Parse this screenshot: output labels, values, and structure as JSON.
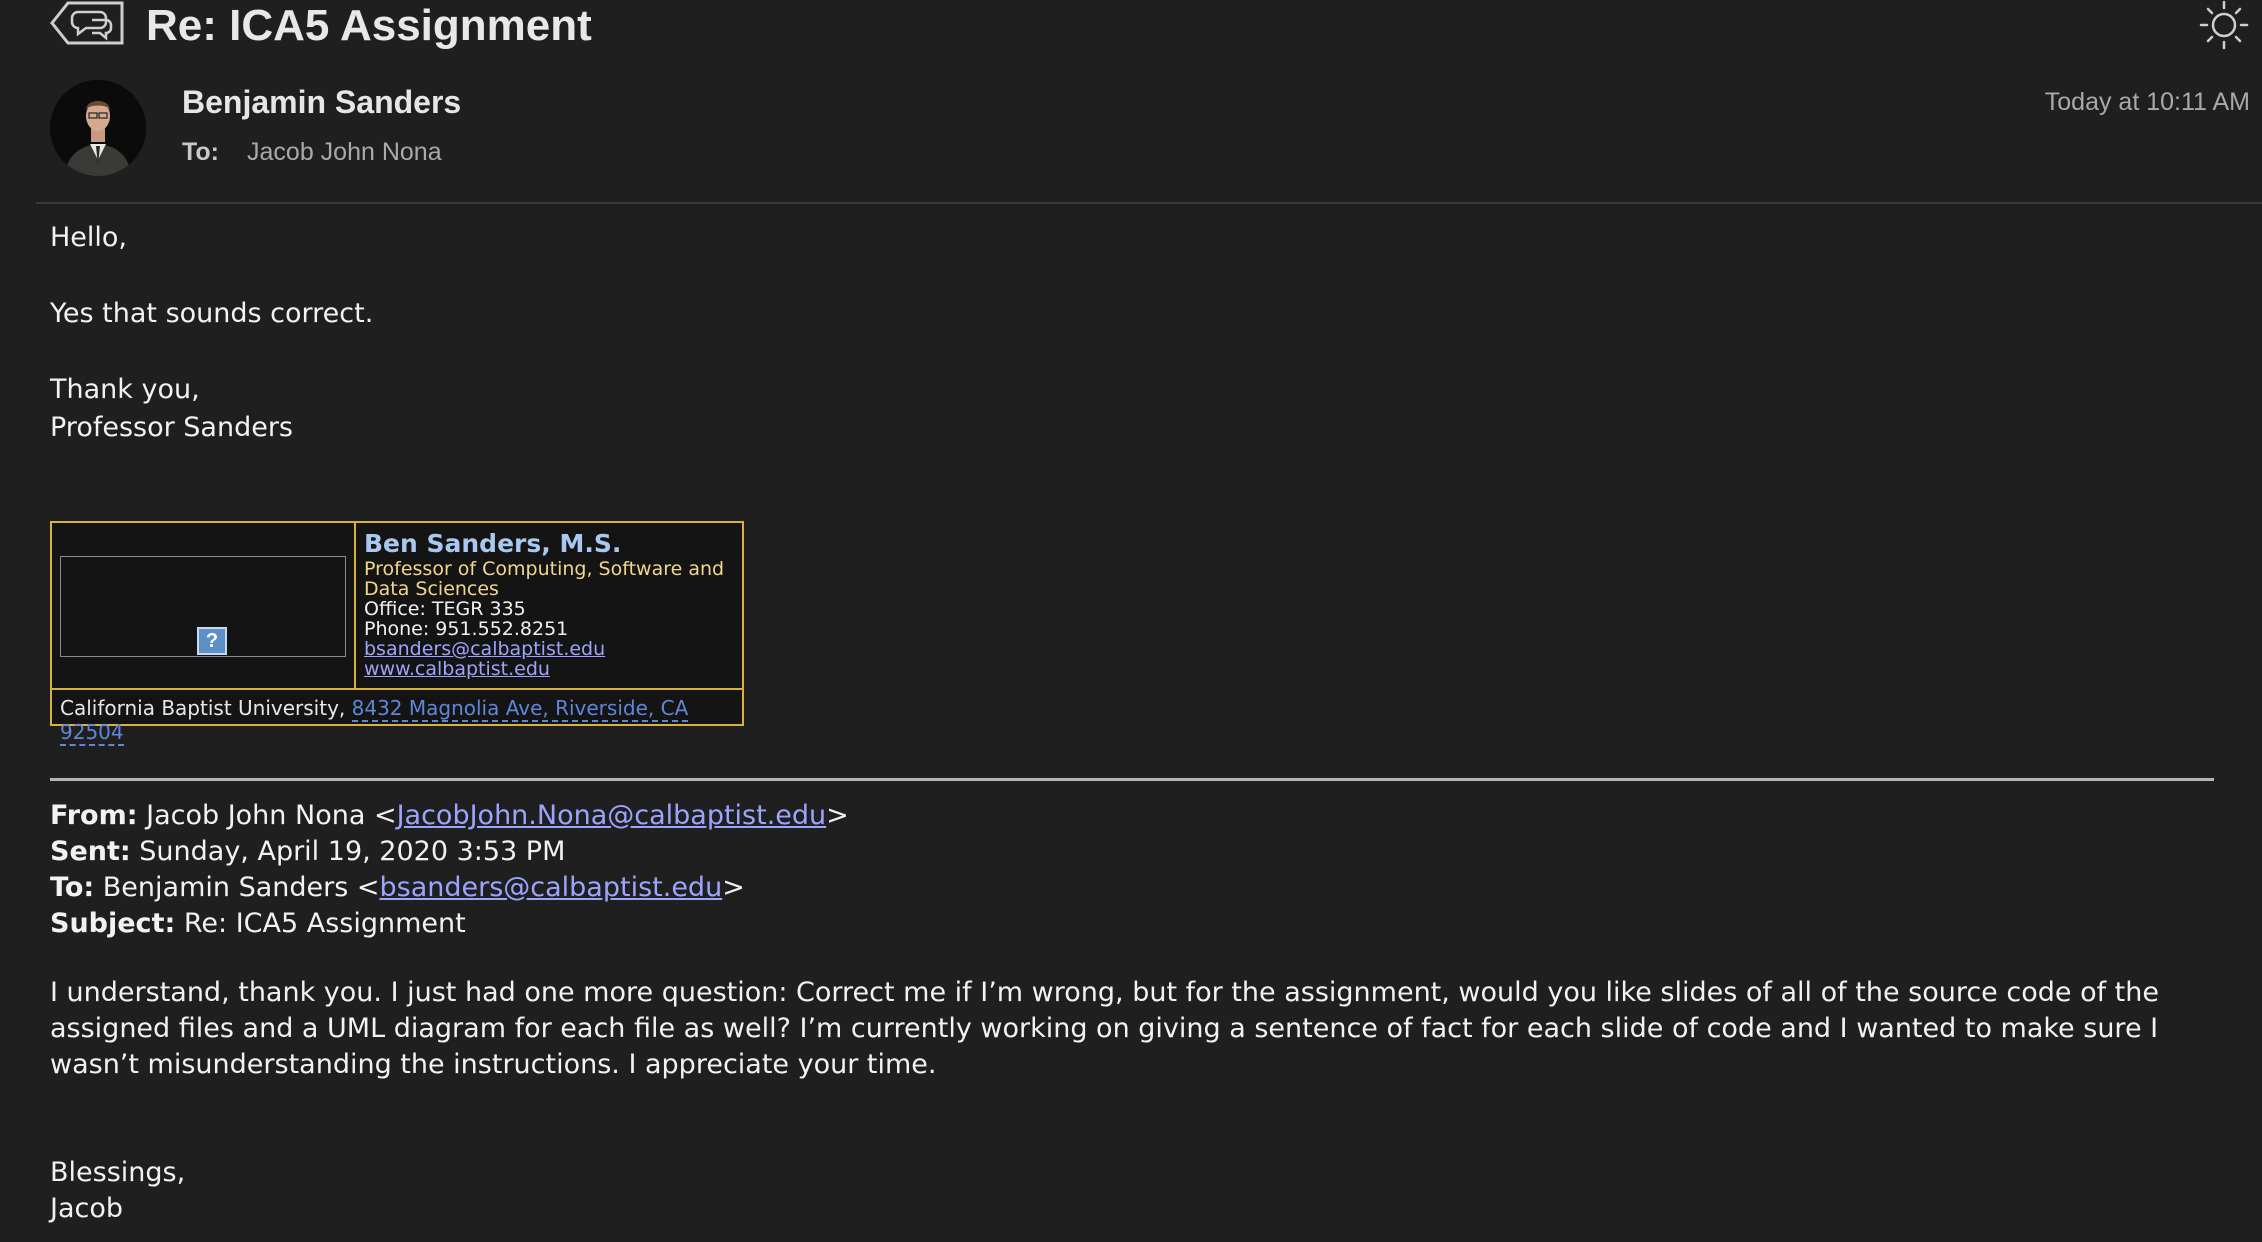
{
  "header": {
    "subject": "Re: ICA5 Assignment",
    "sender": "Benjamin Sanders",
    "to_label": "To:",
    "recipient": "Jacob John Nona",
    "timestamp": "Today at 10:11 AM"
  },
  "reply": {
    "greeting": "Hello,",
    "line1": "Yes that sounds correct.",
    "closing": "Thank you,",
    "signoff": "Professor Sanders"
  },
  "signature": {
    "image_placeholder": "?",
    "name": "Ben Sanders, M.S.",
    "title": "Professor of Computing, Software and Data Sciences",
    "office": "Office: TEGR 335",
    "phone": "Phone: 951.552.8251",
    "email": "bsanders@calbaptist.edu",
    "website": "www.calbaptist.edu",
    "university": "California Baptist University,",
    "address": "8432 Magnolia Ave, Riverside, CA 92504"
  },
  "quoted": {
    "from_label": "From:",
    "from_name": "Jacob John Nona <",
    "from_email": "JacobJohn.Nona@calbaptist.edu",
    "close_bracket": ">",
    "sent_label": "Sent:",
    "sent_value": "Sunday, April 19, 2020 3:53 PM",
    "to_label": "To:",
    "to_name": "Benjamin Sanders <",
    "to_email": "bsanders@calbaptist.edu",
    "subject_label": "Subject:",
    "subject_value": "Re: ICA5 Assignment",
    "message": "I understand, thank you. I just had one more question: Correct me if I’m wrong, but for the assignment, would you like slides of all of the source code of the assigned files and a UML diagram for each file as well? I’m currently working on giving a sentence of fact for each slide of code and I wanted to make sure I wasn’t misunderstanding the instructions. I appreciate your time.",
    "blessing": "Blessings,",
    "name": "Jacob"
  },
  "colors": {
    "background": "#1f1f20",
    "link": "#9ea3ff",
    "signature_border": "#d8b240",
    "signature_name": "#a8c8f0",
    "signature_title": "#f1d78a"
  }
}
